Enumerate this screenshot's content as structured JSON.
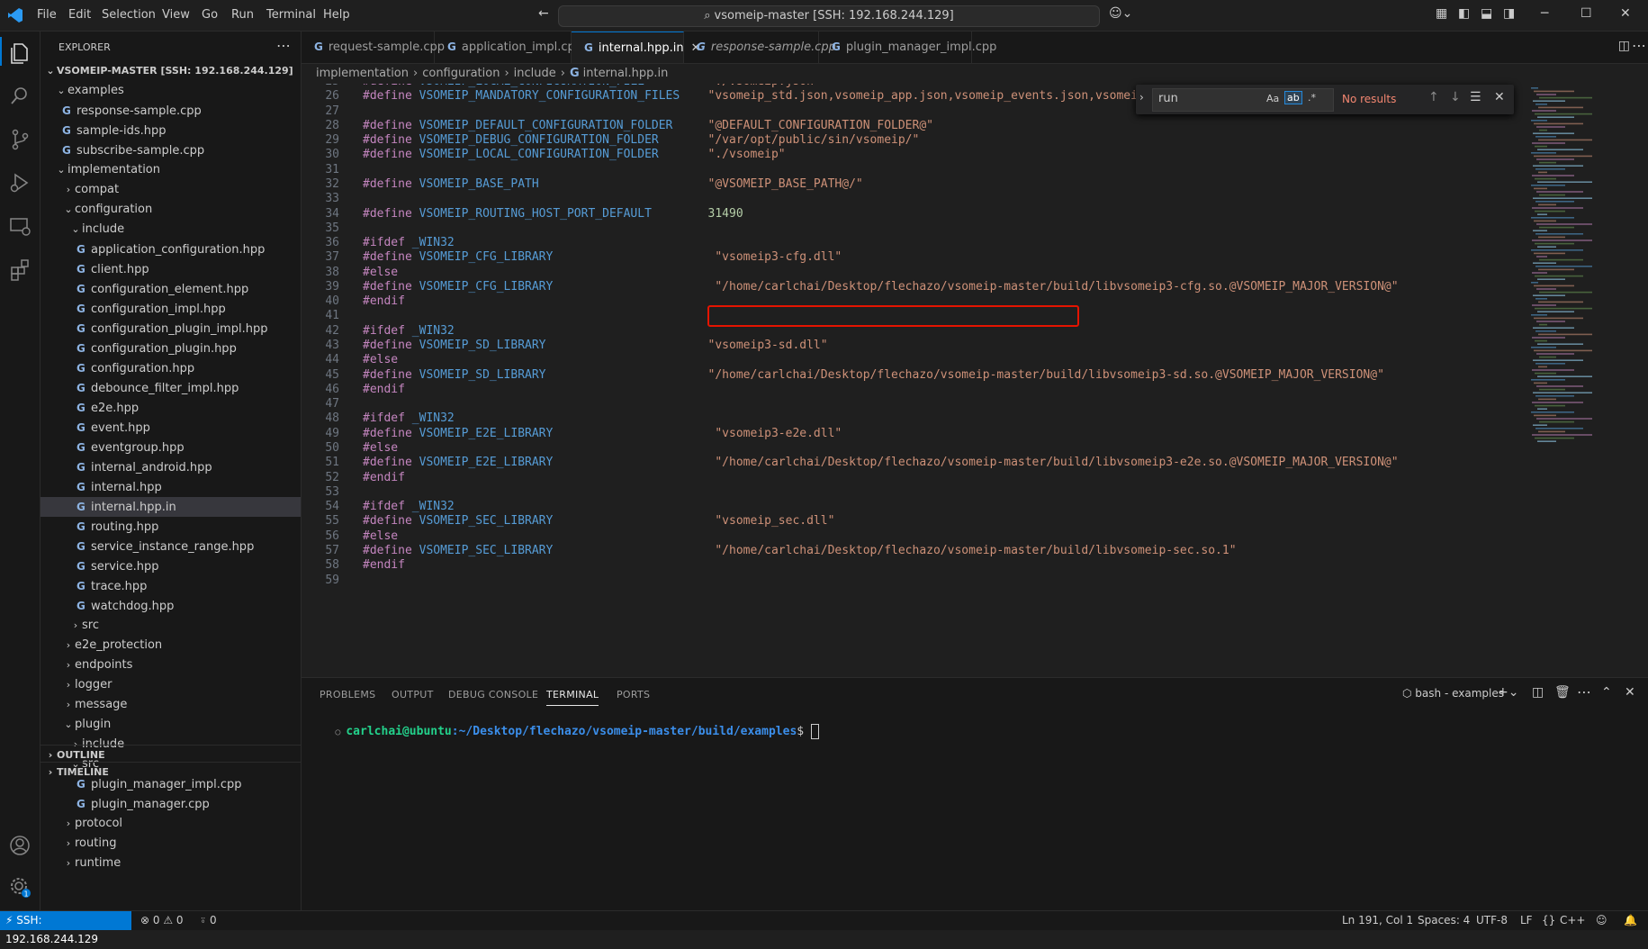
{
  "menu": [
    "File",
    "Edit",
    "Selection",
    "View",
    "Go",
    "Run",
    "Terminal",
    "Help"
  ],
  "search_title": "vsomeip-master [SSH: 192.168.244.129]",
  "sidebar": {
    "header": "EXPLORER",
    "root": "VSOMEIP-MASTER [SSH: 192.168.244.129]",
    "rows": [
      {
        "label": "examples",
        "depth": 1,
        "type": "folder-open"
      },
      {
        "label": "response-sample.cpp",
        "depth": 2,
        "type": "file"
      },
      {
        "label": "sample-ids.hpp",
        "depth": 2,
        "type": "file"
      },
      {
        "label": "subscribe-sample.cpp",
        "depth": 2,
        "type": "file"
      },
      {
        "label": "implementation",
        "depth": 1,
        "type": "folder-open"
      },
      {
        "label": "compat",
        "depth": 2,
        "type": "folder"
      },
      {
        "label": "configuration",
        "depth": 2,
        "type": "folder-open"
      },
      {
        "label": "include",
        "depth": 3,
        "type": "folder-open"
      },
      {
        "label": "application_configuration.hpp",
        "depth": 4,
        "type": "file"
      },
      {
        "label": "client.hpp",
        "depth": 4,
        "type": "file"
      },
      {
        "label": "configuration_element.hpp",
        "depth": 4,
        "type": "file"
      },
      {
        "label": "configuration_impl.hpp",
        "depth": 4,
        "type": "file"
      },
      {
        "label": "configuration_plugin_impl.hpp",
        "depth": 4,
        "type": "file"
      },
      {
        "label": "configuration_plugin.hpp",
        "depth": 4,
        "type": "file"
      },
      {
        "label": "configuration.hpp",
        "depth": 4,
        "type": "file"
      },
      {
        "label": "debounce_filter_impl.hpp",
        "depth": 4,
        "type": "file"
      },
      {
        "label": "e2e.hpp",
        "depth": 4,
        "type": "file"
      },
      {
        "label": "event.hpp",
        "depth": 4,
        "type": "file"
      },
      {
        "label": "eventgroup.hpp",
        "depth": 4,
        "type": "file"
      },
      {
        "label": "internal_android.hpp",
        "depth": 4,
        "type": "file"
      },
      {
        "label": "internal.hpp",
        "depth": 4,
        "type": "file"
      },
      {
        "label": "internal.hpp.in",
        "depth": 4,
        "type": "file",
        "selected": true
      },
      {
        "label": "routing.hpp",
        "depth": 4,
        "type": "file"
      },
      {
        "label": "service_instance_range.hpp",
        "depth": 4,
        "type": "file"
      },
      {
        "label": "service.hpp",
        "depth": 4,
        "type": "file"
      },
      {
        "label": "trace.hpp",
        "depth": 4,
        "type": "file"
      },
      {
        "label": "watchdog.hpp",
        "depth": 4,
        "type": "file"
      },
      {
        "label": "src",
        "depth": 3,
        "type": "folder"
      },
      {
        "label": "e2e_protection",
        "depth": 2,
        "type": "folder"
      },
      {
        "label": "endpoints",
        "depth": 2,
        "type": "folder"
      },
      {
        "label": "logger",
        "depth": 2,
        "type": "folder"
      },
      {
        "label": "message",
        "depth": 2,
        "type": "folder"
      },
      {
        "label": "plugin",
        "depth": 2,
        "type": "folder-open"
      },
      {
        "label": "include",
        "depth": 3,
        "type": "folder"
      },
      {
        "label": "src",
        "depth": 3,
        "type": "folder-open"
      },
      {
        "label": "plugin_manager_impl.cpp",
        "depth": 4,
        "type": "file"
      },
      {
        "label": "plugin_manager.cpp",
        "depth": 4,
        "type": "file"
      },
      {
        "label": "protocol",
        "depth": 2,
        "type": "folder"
      },
      {
        "label": "routing",
        "depth": 2,
        "type": "folder"
      },
      {
        "label": "runtime",
        "depth": 2,
        "type": "folder"
      }
    ],
    "outline": "OUTLINE",
    "timeline": "TIMELINE"
  },
  "tabs": [
    {
      "label": "request-sample.cpp",
      "active": false,
      "italic": false
    },
    {
      "label": "application_impl.cpp",
      "active": false,
      "italic": false
    },
    {
      "label": "internal.hpp.in",
      "active": true,
      "italic": false
    },
    {
      "label": "response-sample.cpp",
      "active": false,
      "italic": true
    },
    {
      "label": "plugin_manager_impl.cpp",
      "active": false,
      "italic": false
    }
  ],
  "breadcrumb": [
    "implementation",
    "configuration",
    "include",
    "internal.hpp.in"
  ],
  "code": [
    {
      "n": "25",
      "t": "#define VSOMEIP_LOCAL_CONFIGURATION_FILE",
      "v": "\"./vsomeip.json\""
    },
    {
      "n": "26",
      "t": "#define VSOMEIP_MANDATORY_CONFIGURATION_FILES",
      "v": "\"vsomeip_std.json,vsomeip_app.json,vsomeip_events.json,vsomeip_p"
    },
    {
      "n": "27",
      "t": "",
      "v": ""
    },
    {
      "n": "28",
      "t": "#define VSOMEIP_DEFAULT_CONFIGURATION_FOLDER",
      "v": "\"@DEFAULT_CONFIGURATION_FOLDER@\""
    },
    {
      "n": "29",
      "t": "#define VSOMEIP_DEBUG_CONFIGURATION_FOLDER",
      "v": "\"/var/opt/public/sin/vsomeip/\""
    },
    {
      "n": "30",
      "t": "#define VSOMEIP_LOCAL_CONFIGURATION_FOLDER",
      "v": "\"./vsomeip\""
    },
    {
      "n": "31",
      "t": "",
      "v": ""
    },
    {
      "n": "32",
      "t": "#define VSOMEIP_BASE_PATH",
      "v": "\"@VSOMEIP_BASE_PATH@/\""
    },
    {
      "n": "33",
      "t": "",
      "v": ""
    },
    {
      "n": "34",
      "t": "#define VSOMEIP_ROUTING_HOST_PORT_DEFAULT",
      "v": "31490",
      "num": true
    },
    {
      "n": "35",
      "t": "",
      "v": ""
    },
    {
      "n": "36",
      "t": "#ifdef _WIN32",
      "v": ""
    },
    {
      "n": "37",
      "t": "#define VSOMEIP_CFG_LIBRARY",
      "v": " \"vsomeip3-cfg.dll\""
    },
    {
      "n": "38",
      "t": "#else",
      "v": ""
    },
    {
      "n": "39",
      "t": "#define VSOMEIP_CFG_LIBRARY",
      "v": " \"/home/carlchai/Desktop/flechazo/vsomeip-master/build/libvsomeip3-cfg.so.@VSOMEIP_MAJOR_VERSION@\""
    },
    {
      "n": "40",
      "t": "#endif",
      "v": ""
    },
    {
      "n": "41",
      "t": "",
      "v": ""
    },
    {
      "n": "42",
      "t": "#ifdef _WIN32",
      "v": ""
    },
    {
      "n": "43",
      "t": "#define VSOMEIP_SD_LIBRARY",
      "v": "\"vsomeip3-sd.dll\""
    },
    {
      "n": "44",
      "t": "#else",
      "v": ""
    },
    {
      "n": "45",
      "t": "#define VSOMEIP_SD_LIBRARY",
      "v": "\"/home/carlchai/Desktop/flechazo/vsomeip-master/build/libvsomeip3-sd.so.@VSOMEIP_MAJOR_VERSION@\""
    },
    {
      "n": "46",
      "t": "#endif",
      "v": ""
    },
    {
      "n": "47",
      "t": "",
      "v": ""
    },
    {
      "n": "48",
      "t": "#ifdef _WIN32",
      "v": ""
    },
    {
      "n": "49",
      "t": "#define VSOMEIP_E2E_LIBRARY",
      "v": " \"vsomeip3-e2e.dll\""
    },
    {
      "n": "50",
      "t": "#else",
      "v": ""
    },
    {
      "n": "51",
      "t": "#define VSOMEIP_E2E_LIBRARY",
      "v": " \"/home/carlchai/Desktop/flechazo/vsomeip-master/build/libvsomeip3-e2e.so.@VSOMEIP_MAJOR_VERSION@\""
    },
    {
      "n": "52",
      "t": "#endif",
      "v": ""
    },
    {
      "n": "53",
      "t": "",
      "v": ""
    },
    {
      "n": "54",
      "t": "#ifdef _WIN32",
      "v": ""
    },
    {
      "n": "55",
      "t": "#define VSOMEIP_SEC_LIBRARY",
      "v": " \"vsomeip_sec.dll\""
    },
    {
      "n": "56",
      "t": "#else",
      "v": ""
    },
    {
      "n": "57",
      "t": "#define VSOMEIP_SEC_LIBRARY",
      "v": " \"/home/carlchai/Desktop/flechazo/vsomeip-master/build/libvsomeip-sec.so.1\""
    },
    {
      "n": "58",
      "t": "#endif",
      "v": ""
    },
    {
      "n": "59",
      "t": "",
      "v": ""
    }
  ],
  "find": {
    "query": "run",
    "match_case": "Aa",
    "whole_word": "ab",
    "regex": ".*",
    "result": "No results"
  },
  "panel": {
    "tabs": [
      "PROBLEMS",
      "OUTPUT",
      "DEBUG CONSOLE",
      "TERMINAL",
      "PORTS"
    ],
    "active_tab": "TERMINAL",
    "terminal_name": "bash - examples",
    "prompt_user": "carlchai@ubuntu",
    "prompt_path": ":~/Desktop/flechazo/vsomeip-master/build/examples",
    "prompt_symbol": "$"
  },
  "status": {
    "remote": "SSH: 192.168.244.129",
    "errors": "0",
    "warnings": "0",
    "ports": "0",
    "position": "Ln 191, Col 1",
    "spaces": "Spaces: 4",
    "encoding": "UTF-8",
    "eol": "LF",
    "language": "C++"
  },
  "colors": {
    "accent": "#0078d4",
    "highlight_box": "#e51400"
  }
}
